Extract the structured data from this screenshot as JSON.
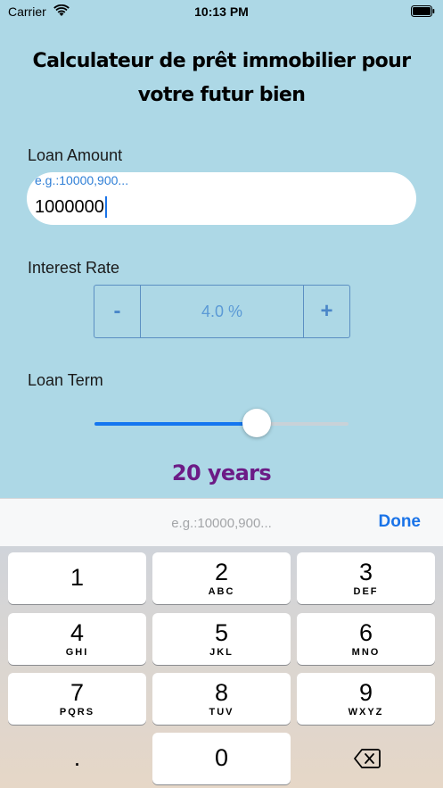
{
  "status_bar": {
    "carrier": "Carrier",
    "time": "10:13 PM"
  },
  "title": "Calculateur de prêt immobilier pour votre futur bien",
  "loan_amount": {
    "label": "Loan Amount",
    "placeholder": "e.g.:10000,900...",
    "value": "1000000"
  },
  "interest_rate": {
    "label": "Interest Rate",
    "minus": "-",
    "plus": "+",
    "value": "4.0 %"
  },
  "loan_term": {
    "label": "Loan Term",
    "slider_fraction": 0.64,
    "display": "20 years"
  },
  "accessory": {
    "placeholder": "e.g.:10000,900...",
    "done": "Done"
  },
  "keyboard": {
    "keys": [
      {
        "digit": "1",
        "letters": ""
      },
      {
        "digit": "2",
        "letters": "ABC"
      },
      {
        "digit": "3",
        "letters": "DEF"
      },
      {
        "digit": "4",
        "letters": "GHI"
      },
      {
        "digit": "5",
        "letters": "JKL"
      },
      {
        "digit": "6",
        "letters": "MNO"
      },
      {
        "digit": "7",
        "letters": "PQRS"
      },
      {
        "digit": "8",
        "letters": "TUV"
      },
      {
        "digit": "9",
        "letters": "WXYZ"
      },
      {
        "digit": ".",
        "letters": ""
      },
      {
        "digit": "0",
        "letters": ""
      }
    ]
  },
  "colors": {
    "background": "#add8e6",
    "accent": "#1a73e8",
    "years": "#6c1b86"
  },
  "icons": {
    "wifi": "wifi-icon",
    "battery": "battery-icon",
    "delete": "backspace-icon"
  }
}
